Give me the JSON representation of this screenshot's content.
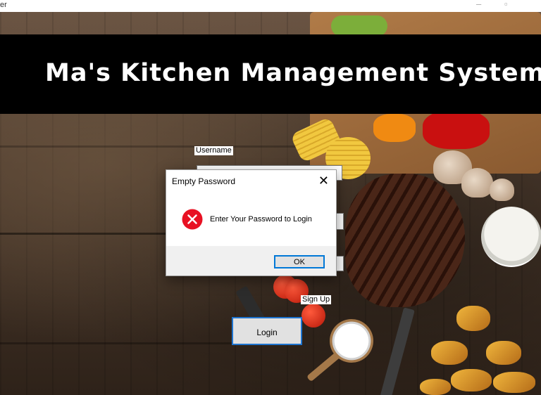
{
  "window": {
    "title_fragment": "er"
  },
  "banner": {
    "title": "Ma's Kitchen Management System"
  },
  "form": {
    "username_label": "Username",
    "signup_label": "Sign Up",
    "login_button": "Login"
  },
  "dialog": {
    "title": "Empty Password",
    "message": "Enter Your Password to Login",
    "ok_button": "OK",
    "icon": "error-icon"
  },
  "colors": {
    "banner_bg": "#000000",
    "dialog_accent": "#0078d7",
    "error_red": "#e81123"
  }
}
